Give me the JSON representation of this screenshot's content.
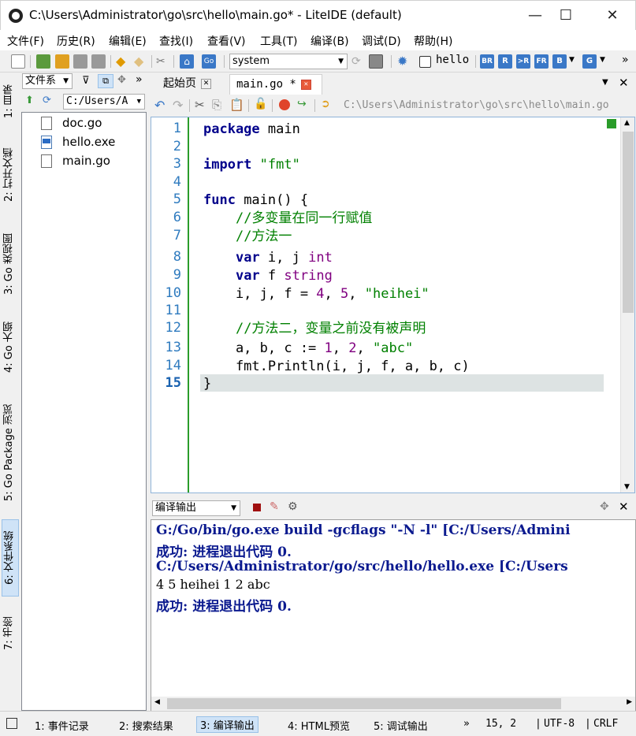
{
  "window": {
    "title": "C:\\Users\\Administrator\\go\\src\\hello\\main.go* - LiteIDE (default)",
    "min": "—",
    "max": "☐",
    "close": "✕"
  },
  "menu": [
    "文件(F)",
    "历史(R)",
    "编辑(E)",
    "查找(I)",
    "查看(V)",
    "工具(T)",
    "编译(B)",
    "调试(D)",
    "帮助(H)"
  ],
  "toolbar": {
    "env": "system",
    "target": "hello",
    "buttons": [
      "BR",
      "R",
      ">R",
      "FR",
      "B",
      "G"
    ]
  },
  "left_tabs": [
    "1: 目录",
    "2: 打开文档",
    "3: Go 类视图",
    "4: Go 大纲",
    "5: Go Package 浏览",
    "6: 文件系统",
    "7: 书签"
  ],
  "filesystem": {
    "view": "文件系",
    "path": "C:/Users/A",
    "files": [
      "doc.go",
      "hello.exe",
      "main.go"
    ]
  },
  "tabs": [
    {
      "label": "起始页"
    },
    {
      "label": "main.go *"
    }
  ],
  "breadcrumb": "C:\\Users\\Administrator\\go\\src\\hello\\main.go",
  "editor": {
    "line_numbers": [
      "1",
      "2",
      "3",
      "4",
      "5",
      "6",
      "7",
      "8",
      "9",
      "10",
      "11",
      "12",
      "13",
      "14",
      "15"
    ],
    "lines": [
      "package main",
      "",
      "import \"fmt\"",
      "",
      "func main() {",
      "    //多变量在同一行赋值",
      "    //方法一",
      "    var i, j int",
      "    var f string",
      "    i, j, f = 4, 5, \"heihei\"",
      "",
      "    //方法二，变量之前没有被声明",
      "    a, b, c := 1, 2, \"abc\"",
      "    fmt.Println(i, j, f, a, b, c)",
      "}"
    ]
  },
  "output": {
    "title": "编译输出",
    "lines": [
      "G:/Go/bin/go.exe build -gcflags \"-N -l\" [C:/Users/Admini",
      "成功: 进程退出代码 0.",
      "C:/Users/Administrator/go/src/hello/hello.exe  [C:/Users",
      "4 5 heihei 1 2 abc",
      "成功: 进程退出代码 0."
    ]
  },
  "status": {
    "tabs": [
      "1: 事件记录",
      "2: 搜索结果",
      "3: 编译输出",
      "4: HTML预览",
      "5: 调试输出"
    ],
    "more": "»",
    "position": "15,  2",
    "encoding": "UTF-8",
    "eol": "CRLF"
  }
}
